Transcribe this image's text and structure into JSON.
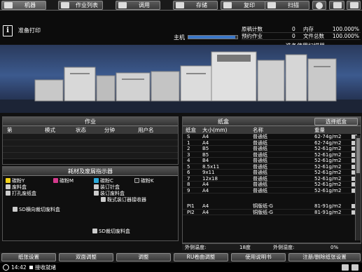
{
  "tabs": [
    {
      "label": "机器",
      "icon": "machine-icon"
    },
    {
      "label": "作业列表",
      "icon": "job-list-icon"
    },
    {
      "label": "调用",
      "icon": "recall-icon"
    },
    {
      "label": "存储",
      "icon": "store-icon"
    },
    {
      "label": "复印",
      "icon": "copy-icon"
    },
    {
      "label": "扫描",
      "icon": "scan-icon"
    }
  ],
  "header": {
    "status_message": "准备打印",
    "host_label": "主机",
    "host_progress": 0.95,
    "scanner_message": "准备使用扫描器"
  },
  "counters": {
    "originals_label": "原稿计数",
    "originals_value": "0",
    "memory_label": "内存",
    "memory_value": "100.000%",
    "reserved_label": "预约作业",
    "reserved_value": "0",
    "file_label": "文件总数",
    "file_value": "100.000%"
  },
  "jobs": {
    "title": "作业",
    "columns": [
      "第",
      "模式",
      "状态",
      "分钟",
      "用户名"
    ]
  },
  "consumables": {
    "title": "耗材及废屑指示器",
    "items": [
      {
        "label": "碳粉Y",
        "color": "#f2d21a"
      },
      {
        "label": "碳粉M",
        "color": "#d43a8c"
      },
      {
        "label": "碳粉C",
        "color": "#2aa8d8"
      },
      {
        "label": "碳粉K",
        "color": "#222222"
      },
      {
        "label": "废料盒"
      },
      {
        "label": "装订针盒"
      },
      {
        "label": "打孔废纸盒"
      },
      {
        "label": "装订废料盒"
      },
      {
        "label": "鞍式装订器接收器"
      },
      {
        "label": "SD横向裁切废料盒"
      },
      {
        "label": "SD裁切废料盒"
      }
    ]
  },
  "paper": {
    "title": "纸盒",
    "select_button": "选择纸盒",
    "columns": [
      "纸盒",
      "大小(mm)",
      "名称",
      "重量"
    ],
    "rows": [
      {
        "tray": "S",
        "size": "A4",
        "name": "普通纸",
        "weight": "62-74g/m2"
      },
      {
        "tray": "1",
        "size": "A4",
        "name": "普通纸",
        "weight": "62-74g/m2"
      },
      {
        "tray": "2",
        "size": "B5",
        "name": "普通纸",
        "weight": "52-61g/m2"
      },
      {
        "tray": "3",
        "size": "B5",
        "name": "普通纸",
        "weight": "52-61g/m2"
      },
      {
        "tray": "4",
        "size": "B4",
        "name": "普通纸",
        "weight": "52-61g/m2"
      },
      {
        "tray": "5",
        "size": "8.5x11",
        "name": "普通纸",
        "weight": "52-61g/m2"
      },
      {
        "tray": "6",
        "size": "9x11",
        "name": "普通纸",
        "weight": "52-61g/m2"
      },
      {
        "tray": "7",
        "size": "12x18",
        "name": "普通纸",
        "weight": "52-61g/m2"
      },
      {
        "tray": "8",
        "size": "A4",
        "name": "普通纸",
        "weight": "52-61g/m2"
      },
      {
        "tray": "9",
        "size": "A4",
        "name": "普通纸",
        "weight": "52-61g/m2"
      },
      {
        "tray": "PI1",
        "size": "A4",
        "name": "铜版纸-G",
        "weight": "81-91g/m2"
      },
      {
        "tray": "PI2",
        "size": "A4",
        "name": "铜版纸-G",
        "weight": "81-91g/m2"
      }
    ],
    "outside_temp_label": "外侧温度:",
    "outside_temp_value": "18度",
    "outside_humidity_label": "外侧湿度:",
    "outside_humidity_value": "0%"
  },
  "bottom_buttons": [
    "纸张设置",
    "双面调整",
    "调整",
    "RU卷曲调整",
    "使用说明书",
    "注册/删除纸张设置"
  ],
  "statusbar": {
    "time": "14:42",
    "message": "接收就绪"
  }
}
